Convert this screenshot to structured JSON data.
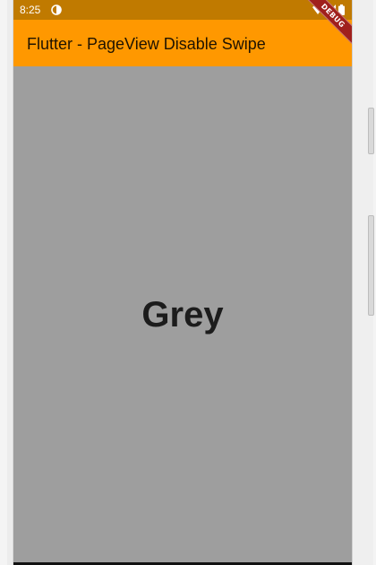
{
  "status_bar": {
    "time": "8:25",
    "color": "#c07a00"
  },
  "app_bar": {
    "title": "Flutter - PageView Disable Swipe",
    "color": "#ff9800"
  },
  "debug_banner": {
    "label": "DEBUG",
    "color": "#a0201c"
  },
  "page": {
    "label": "Grey",
    "background": "#9e9e9e"
  }
}
